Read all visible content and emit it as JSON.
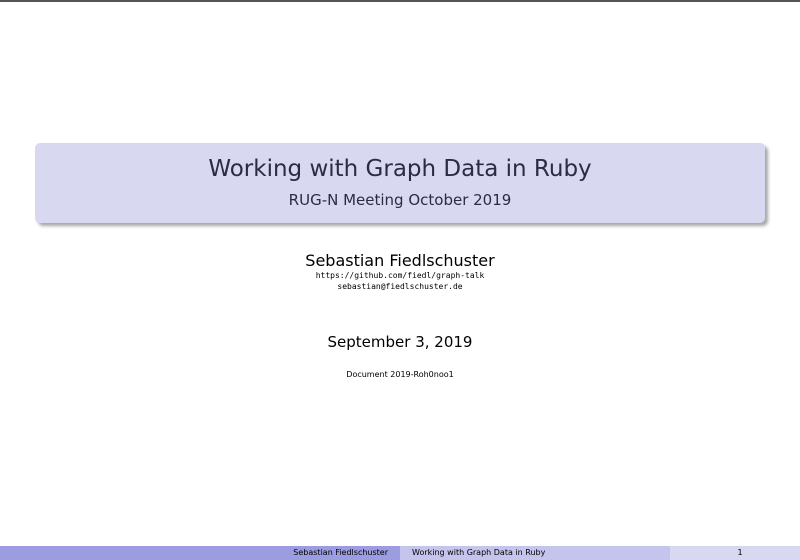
{
  "slide": {
    "title": "Working with Graph Data in Ruby",
    "subtitle": "RUG-N Meeting October 2019",
    "author": "Sebastian Fiedlschuster",
    "url": "https://github.com/fiedl/graph-talk",
    "email": "sebastian@fiedlschuster.de",
    "date": "September 3, 2019",
    "document_id": "Document 2019-Roh0noo1"
  },
  "footer": {
    "author": "Sebastian Fiedlschuster",
    "title": "Working with Graph Data in Ruby",
    "page_number": "1"
  },
  "colors": {
    "title_box": "#d8d8f0",
    "title_text": "#2b2b42",
    "footer_left": "#9c9ce0",
    "footer_mid": "#c4c4ec",
    "footer_right": "#d8d8f0"
  }
}
